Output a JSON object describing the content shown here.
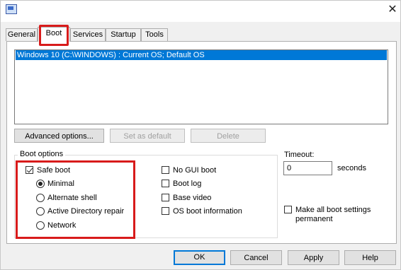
{
  "window": {
    "close_glyph": "✕",
    "icon": "msconfig-app-icon"
  },
  "tabs": [
    {
      "label": "General",
      "active": false
    },
    {
      "label": "Boot",
      "active": true
    },
    {
      "label": "Services",
      "active": false
    },
    {
      "label": "Startup",
      "active": false
    },
    {
      "label": "Tools",
      "active": false
    }
  ],
  "os_list": {
    "entries": [
      "Windows 10 (C:\\WINDOWS) : Current OS; Default OS"
    ],
    "selected_index": 0
  },
  "list_buttons": {
    "advanced": "Advanced options...",
    "set_default": "Set as default",
    "delete": "Delete"
  },
  "boot_options": {
    "group_label": "Boot options",
    "safe_boot": {
      "label": "Safe boot",
      "checked": true
    },
    "radios": [
      {
        "label": "Minimal",
        "checked": true
      },
      {
        "label": "Alternate shell",
        "checked": false
      },
      {
        "label": "Active Directory repair",
        "checked": false
      },
      {
        "label": "Network",
        "checked": false
      }
    ],
    "checks": [
      {
        "label": "No GUI boot",
        "checked": false
      },
      {
        "label": "Boot log",
        "checked": false
      },
      {
        "label": "Base video",
        "checked": false
      },
      {
        "label": "OS boot information",
        "checked": false
      }
    ]
  },
  "timeout": {
    "label": "Timeout:",
    "value": "0",
    "unit": "seconds"
  },
  "make_permanent": {
    "line1": "Make all boot settings",
    "line2": "permanent",
    "checked": false
  },
  "dialog_buttons": {
    "ok": "OK",
    "cancel": "Cancel",
    "apply": "Apply",
    "help": "Help"
  },
  "colors": {
    "selection": "#0078d7",
    "highlight_box": "#d81b1b"
  }
}
